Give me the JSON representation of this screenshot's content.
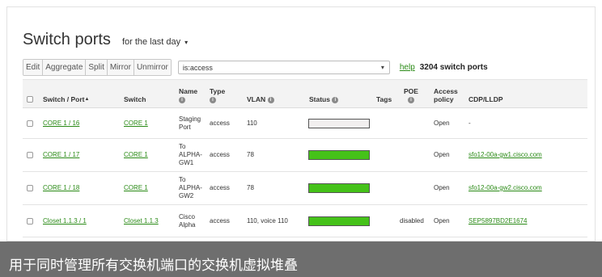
{
  "title": "Switch ports",
  "period": {
    "label": "for the last day",
    "caret": "▾"
  },
  "toolbar": {
    "buttons": [
      "Edit",
      "Aggregate",
      "Split",
      "Mirror",
      "Unmirror"
    ],
    "search_value": "is:access",
    "search_dropdown": "▾",
    "help": "help",
    "count": "3204 switch ports"
  },
  "columns": {
    "switch_port": "Switch / Port",
    "sort_indicator": "▲",
    "switch": "Switch",
    "name": "Name",
    "type": "Type",
    "vlan": "VLAN",
    "status": "Status",
    "tags": "Tags",
    "poe": "POE",
    "access_policy_1": "Access",
    "access_policy_2": "policy",
    "cdp": "CDP/LLDP",
    "info_glyph": "i"
  },
  "rows": [
    {
      "switch_port": "CORE 1 / 16",
      "switch": "CORE 1",
      "name": [
        "Staging",
        "Port"
      ],
      "type": "access",
      "vlan": "110",
      "status_color": "#f2efef",
      "poe": "",
      "access_policy": "Open",
      "cdp": "-",
      "cdp_link": false
    },
    {
      "switch_port": "CORE 1 / 17",
      "switch": "CORE 1",
      "name": [
        "To",
        "ALPHA-",
        "GW1"
      ],
      "type": "access",
      "vlan": "78",
      "status_color": "#45c219",
      "poe": "",
      "access_policy": "Open",
      "cdp": "sfo12-00a-gw1.cisco.com",
      "cdp_link": true
    },
    {
      "switch_port": "CORE 1 / 18",
      "switch": "CORE 1",
      "name": [
        "To",
        "ALPHA-",
        "GW2"
      ],
      "type": "access",
      "vlan": "78",
      "status_color": "#45c219",
      "poe": "",
      "access_policy": "Open",
      "cdp": "sfo12-00a-gw2.cisco.com",
      "cdp_link": true
    },
    {
      "switch_port": "Closet 1.1.3 / 1",
      "switch": "Closet 1.1.3",
      "name": [
        "Cisco",
        "Alpha"
      ],
      "type": "access",
      "vlan": "110, voice 110",
      "status_color": "#45c219",
      "poe": "disabled",
      "access_policy": "Open",
      "cdp": "SEP5897BD2E1674",
      "cdp_link": true
    }
  ],
  "colors": {
    "link": "#2a8a16",
    "status_connected": "#45c219",
    "caption_bg": "#6e6e6e"
  },
  "caption": "用于同时管理所有交换机端口的交换机虚拟堆叠"
}
